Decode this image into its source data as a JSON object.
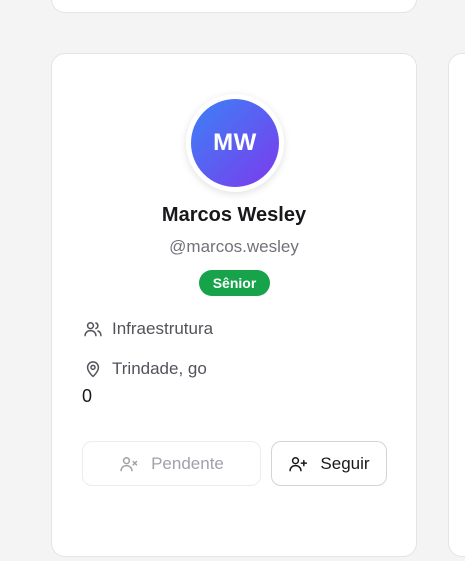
{
  "profile": {
    "initials": "MW",
    "name": "Marcos Wesley",
    "handle": "@marcos.wesley",
    "level": "Sênior",
    "department": "Infraestrutura",
    "location": "Trindade, go",
    "count": "0"
  },
  "actions": {
    "pending_label": "Pendente",
    "follow_label": "Seguir"
  },
  "icons": {
    "department": "users-icon",
    "location": "map-pin-icon",
    "pending": "user-x-icon",
    "follow": "user-plus-icon"
  },
  "colors": {
    "avatar_gradient_start": "#3b82f6",
    "avatar_gradient_end": "#7c3aed",
    "badge": "#16a34a"
  }
}
